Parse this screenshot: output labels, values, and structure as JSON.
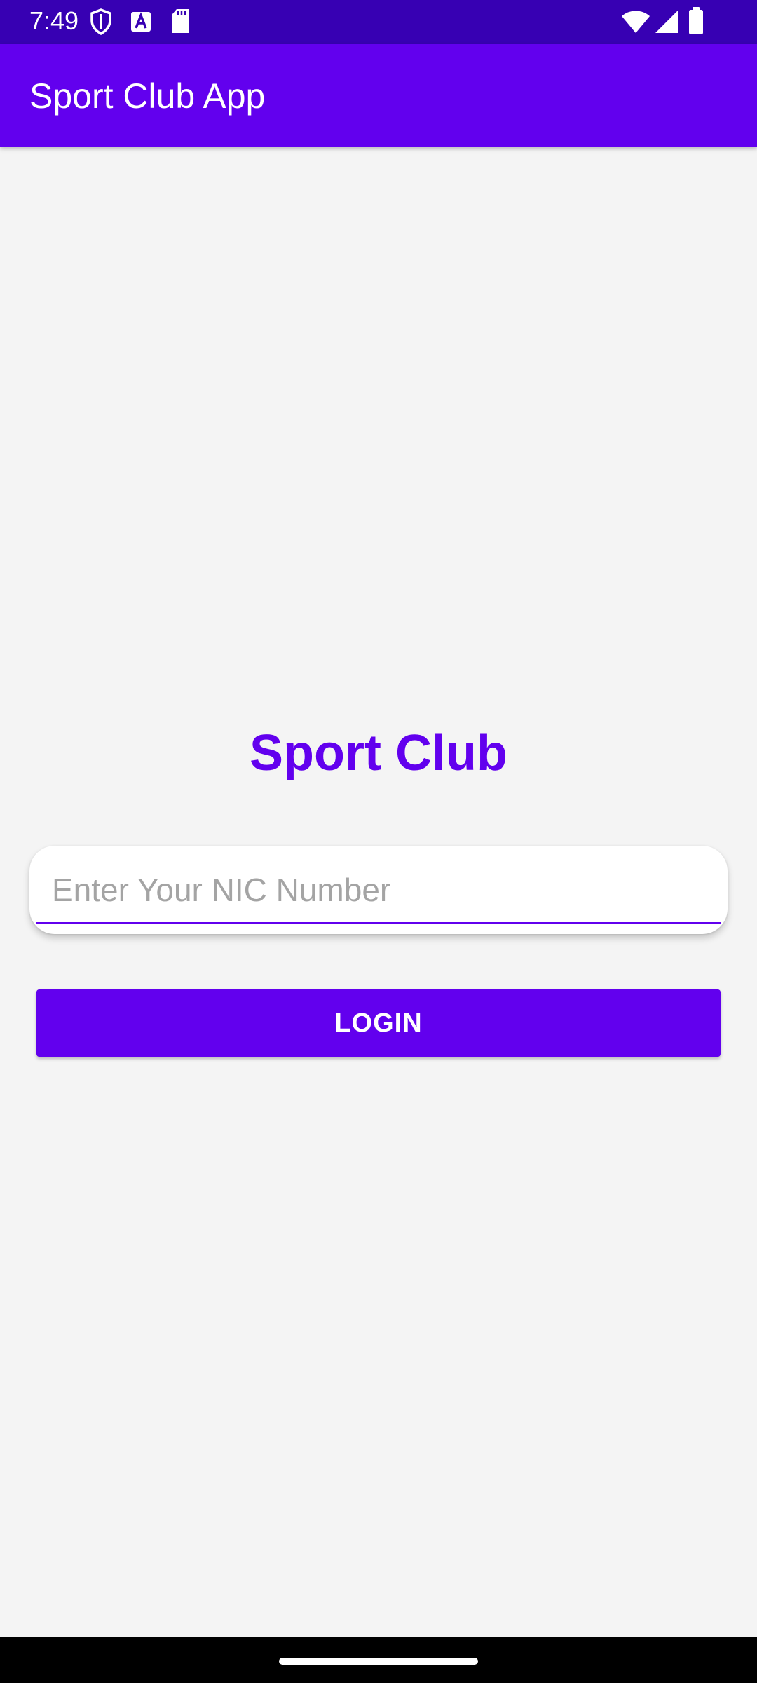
{
  "status_bar": {
    "time": "7:49",
    "icons_left": [
      "shield-icon",
      "font-a-icon",
      "sd-card-icon"
    ],
    "icons_right": [
      "wifi-icon",
      "signal-icon",
      "battery-icon"
    ]
  },
  "app_bar": {
    "title": "Sport Club App",
    "color": "#6200ee"
  },
  "main": {
    "heading": "Sport Club",
    "nic_input": {
      "placeholder": "Enter Your NIC Number",
      "value": ""
    },
    "login_label": "LOGIN"
  },
  "colors": {
    "primary": "#6200ee",
    "primary_dark": "#3700b3",
    "background": "#f4f4f4"
  }
}
